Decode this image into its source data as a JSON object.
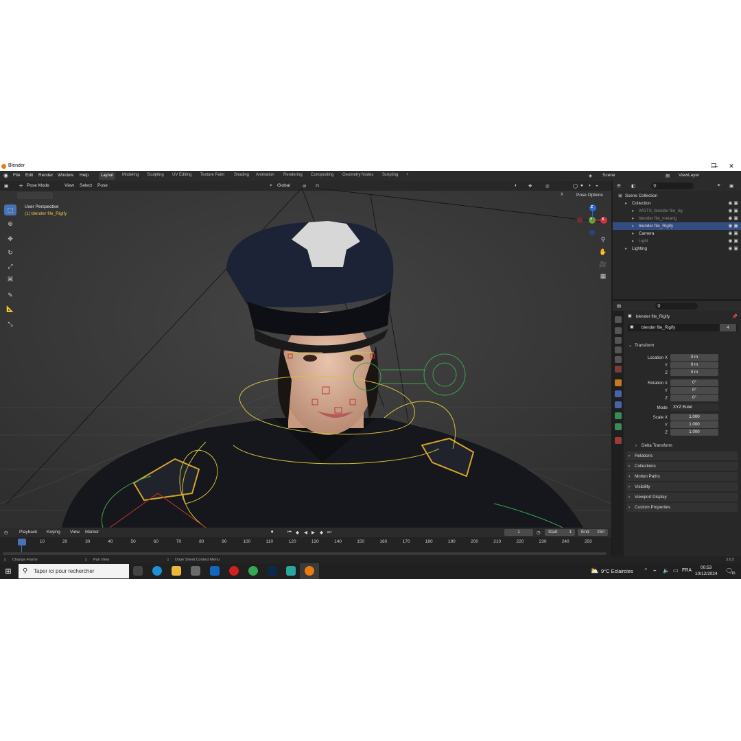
{
  "window": {
    "title": "Blender",
    "min_label": "—",
    "max_label": "❐",
    "close_label": "✕"
  },
  "menu": [
    "File",
    "Edit",
    "Render",
    "Window",
    "Help"
  ],
  "workspaces": [
    "Layout",
    "Modeling",
    "Sculpting",
    "UV Editing",
    "Texture Paint",
    "Shading",
    "Animation",
    "Rendering",
    "Compositing",
    "Geometry Nodes",
    "Scripting",
    "+"
  ],
  "scene": {
    "name": "Scene",
    "view_layer": "ViewLayer"
  },
  "viewport": {
    "mode": "Pose Mode",
    "menus": [
      "View",
      "Select",
      "Pose"
    ],
    "orientation": "Global",
    "pose_options": "Pose Options",
    "x_label": "X",
    "perspective": "User Perspective",
    "object_label": "(1) blender file_Rigify",
    "gizmo": {
      "x": "X",
      "y": "Y",
      "z": "Z"
    }
  },
  "timeline": {
    "menus": [
      "Playback",
      "Keying",
      "View",
      "Marker"
    ],
    "current_frame": "1",
    "start_label": "Start",
    "start": "1",
    "end_label": "End",
    "end": "250",
    "ticks": [
      "1",
      "10",
      "20",
      "30",
      "40",
      "50",
      "60",
      "70",
      "80",
      "90",
      "100",
      "110",
      "120",
      "130",
      "140",
      "150",
      "160",
      "170",
      "180",
      "190",
      "200",
      "210",
      "220",
      "230",
      "240",
      "250"
    ]
  },
  "status": {
    "left": "Change Frame",
    "middle": "Pan View",
    "right": "Dope Sheet Context Menu",
    "version": "3.6.5"
  },
  "outliner": {
    "items": [
      {
        "label": "Scene Collection",
        "indent": 0
      },
      {
        "label": "Collection",
        "indent": 1
      },
      {
        "label": "WGTS_blender file_rig",
        "indent": 2,
        "dim": true
      },
      {
        "label": "blender file_metarig",
        "indent": 2,
        "dim": true
      },
      {
        "label": "blender file_Rigify",
        "indent": 2,
        "selected": true
      },
      {
        "label": "Camera",
        "indent": 2
      },
      {
        "label": "Light",
        "indent": 2,
        "dim": true
      },
      {
        "label": "Lighting",
        "indent": 1
      }
    ]
  },
  "properties": {
    "object_name": "blender file_Rigify",
    "data_name": "blender file_Rigify",
    "users": "4",
    "transform_label": "Transform",
    "location_label": "Location X",
    "location": [
      "0 m",
      "0 m",
      "0 m"
    ],
    "rotation_label": "Rotation X",
    "rotation": [
      "0°",
      "0°",
      "0°"
    ],
    "mode_label": "Mode",
    "mode": "XYZ Euler",
    "scale_label": "Scale X",
    "scale": [
      "1.000",
      "1.000",
      "1.000"
    ],
    "y_label": "Y",
    "z_label": "Z",
    "panels": [
      "Delta Transform",
      "Relations",
      "Collections",
      "Motion Paths",
      "Visibility",
      "Viewport Display",
      "Custom Properties"
    ]
  },
  "taskbar": {
    "search_placeholder": "Taper ici pour rechercher",
    "weather": "9°C  Eclaircies",
    "lang": "FRA",
    "time": "00:53",
    "date": "10/12/2024",
    "notif_count": "15"
  },
  "colors": {
    "accent": "#4772b3",
    "selected_row": "#334d80",
    "rig_yellow": "#d8c23a",
    "rig_green": "#3fa34d",
    "rig_red": "#c0392b"
  }
}
